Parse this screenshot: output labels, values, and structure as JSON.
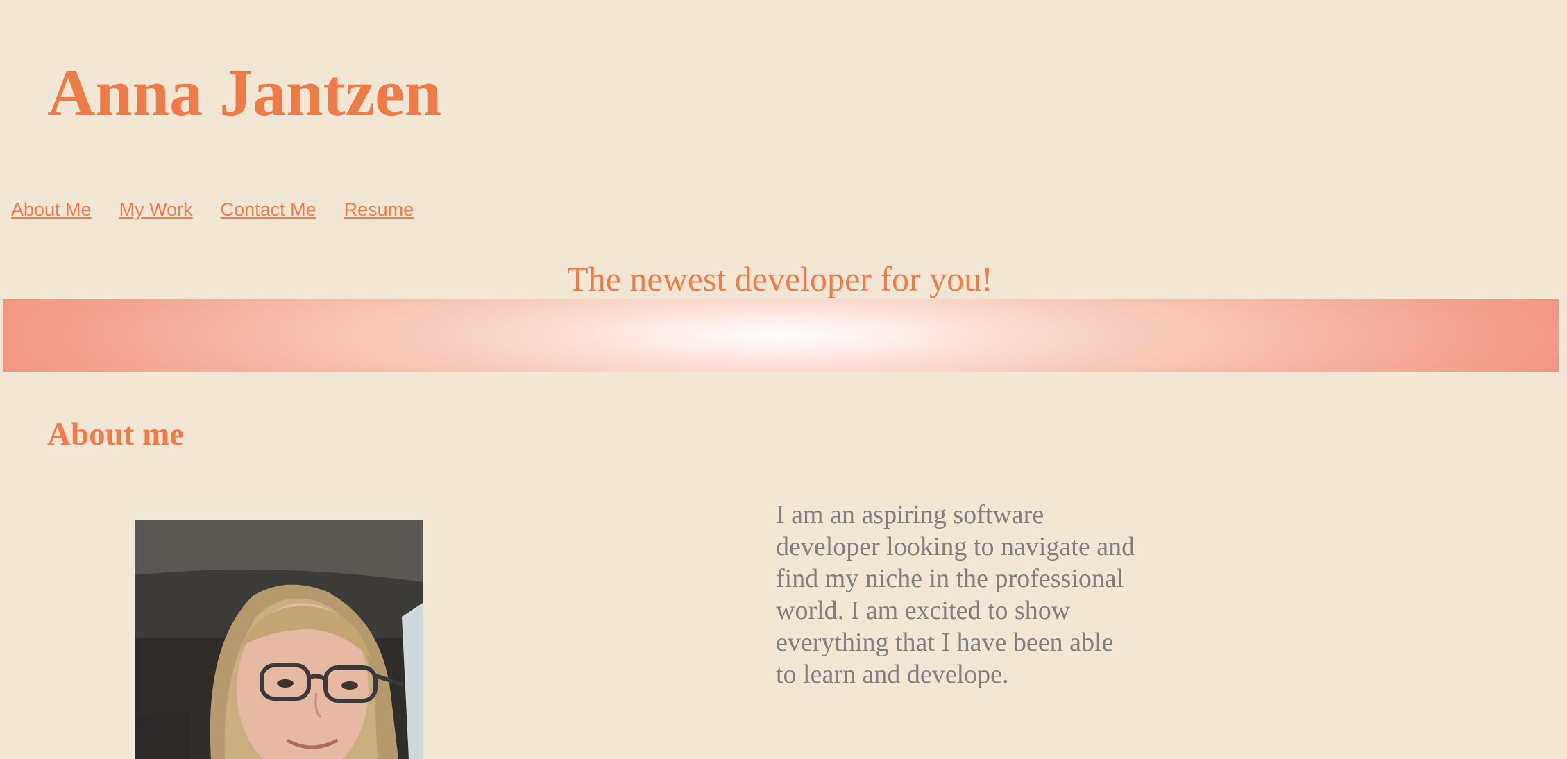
{
  "header": {
    "title": "Anna Jantzen"
  },
  "nav": {
    "items": [
      {
        "label": "About Me"
      },
      {
        "label": "My Work"
      },
      {
        "label": "Contact Me"
      },
      {
        "label": "Resume"
      }
    ]
  },
  "hero": {
    "tagline": "The newest developer for you!"
  },
  "about": {
    "heading": "About me",
    "text": "I am an aspiring software developer looking to navigate and find my niche in the professional world. I am excited to show everything that I have been able to learn and develope.",
    "photo_icon": "profile-photo"
  },
  "colors": {
    "background": "#f2e6d5",
    "accent": "#ef7b48",
    "body_text": "#808080",
    "banner_edge": "#f0836a",
    "banner_center": "#ffffff"
  }
}
